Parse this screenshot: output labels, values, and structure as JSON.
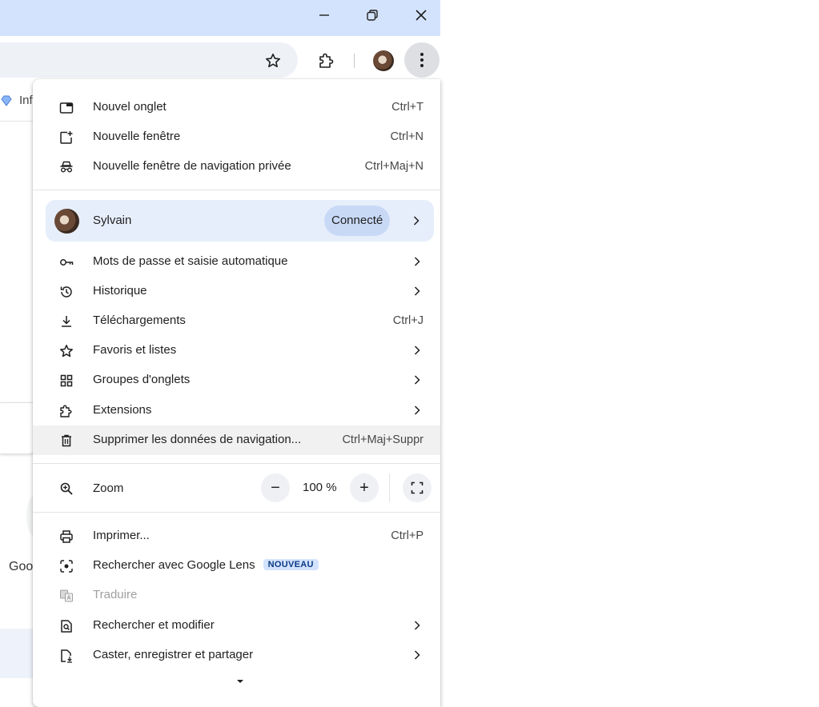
{
  "window": {
    "controls": [
      "minimize-icon",
      "restore-icon",
      "close-icon"
    ]
  },
  "background_page": {
    "bookmark_fragment": "Inf",
    "tile_fragment": "Goo"
  },
  "menu": {
    "new_tab": {
      "label": "Nouvel onglet",
      "shortcut": "Ctrl+T"
    },
    "new_window": {
      "label": "Nouvelle fenêtre",
      "shortcut": "Ctrl+N"
    },
    "incognito": {
      "label": "Nouvelle fenêtre de navigation privée",
      "shortcut": "Ctrl+Maj+N"
    },
    "profile": {
      "name": "Sylvain",
      "status": "Connecté"
    },
    "passwords": {
      "label": "Mots de passe et saisie automatique"
    },
    "history": {
      "label": "Historique"
    },
    "downloads": {
      "label": "Téléchargements",
      "shortcut": "Ctrl+J"
    },
    "bookmarks": {
      "label": "Favoris et listes"
    },
    "tab_groups": {
      "label": "Groupes d'onglets"
    },
    "extensions": {
      "label": "Extensions"
    },
    "clear_data": {
      "label": "Supprimer les données de navigation...",
      "shortcut": "Ctrl+Maj+Suppr"
    },
    "zoom": {
      "label": "Zoom",
      "value": "100 %",
      "minus": "−",
      "plus": "+"
    },
    "print": {
      "label": "Imprimer...",
      "shortcut": "Ctrl+P"
    },
    "lens": {
      "label": "Rechercher avec Google Lens",
      "badge": "NOUVEAU"
    },
    "translate": {
      "label": "Traduire"
    },
    "find_edit": {
      "label": "Rechercher et modifier"
    },
    "cast": {
      "label": "Caster, enregistrer et partager"
    }
  },
  "colors": {
    "accent": "#d3e3fd",
    "profile_bg": "#e7eefb",
    "pill_bg": "#c8d9f6"
  }
}
